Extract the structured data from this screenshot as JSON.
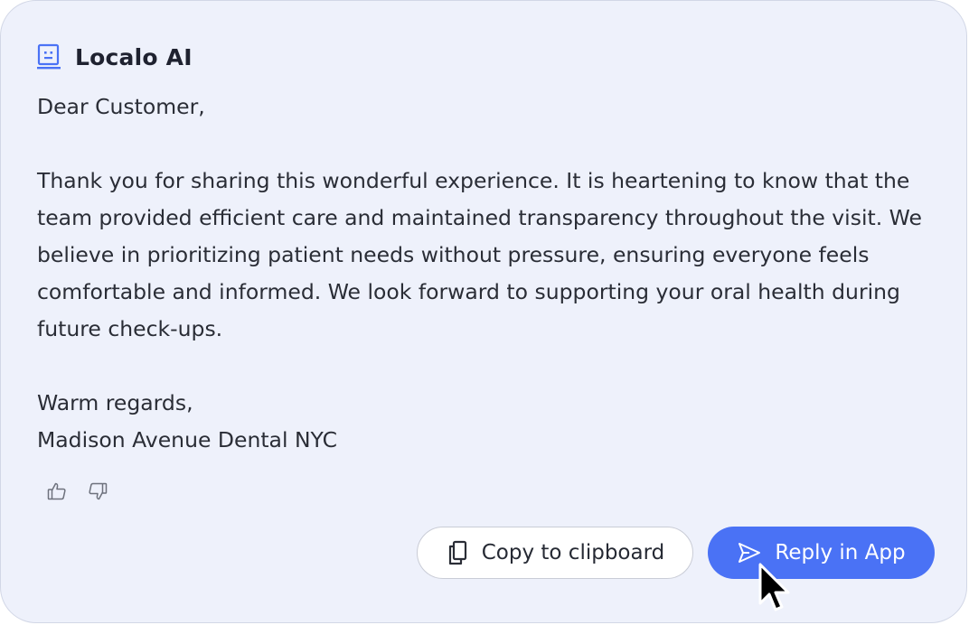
{
  "header": {
    "brand": "Localo AI",
    "icon": "ai-bot-icon"
  },
  "message": {
    "greeting": "Dear Customer,",
    "body": "Thank you for sharing this wonderful experience. It is heartening to know that the team provided efficient care and maintained transparency throughout the visit. We believe in prioritizing patient needs without pressure, ensuring everyone feels comfortable and informed. We look forward to supporting your oral health during future check-ups.",
    "closing": "Warm regards,",
    "signature": "Madison Avenue Dental NYC"
  },
  "feedback": {
    "like_icon": "thumbs-up-icon",
    "dislike_icon": "thumbs-down-icon"
  },
  "actions": {
    "copy_label": "Copy to clipboard",
    "copy_icon": "copy-icon",
    "reply_label": "Reply in App",
    "reply_icon": "send-icon"
  },
  "colors": {
    "card_background": "#eef1fb",
    "accent": "#4a72f5",
    "text": "#2a2d36"
  }
}
